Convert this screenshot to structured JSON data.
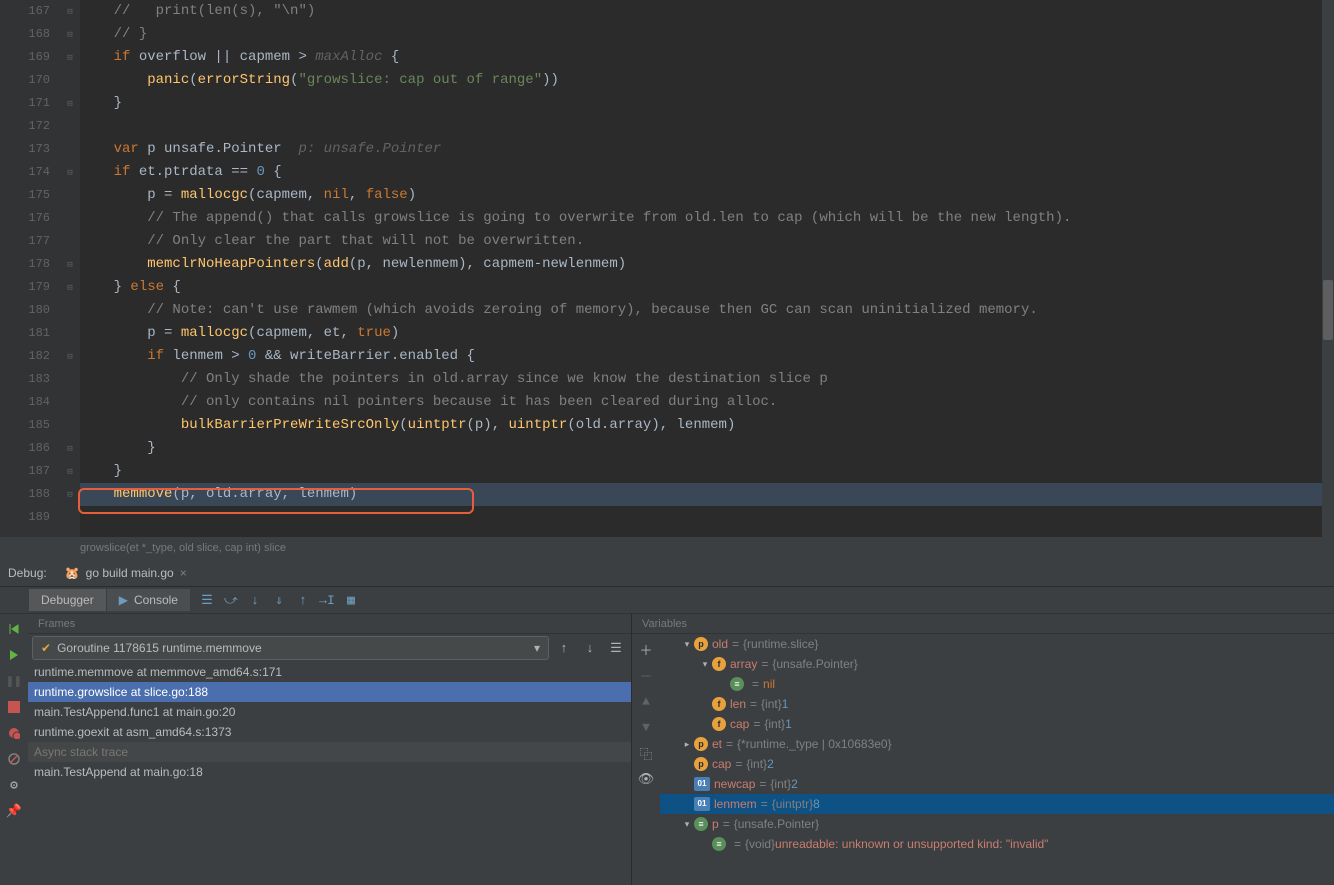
{
  "gutter": {
    "start": 167,
    "end": 189
  },
  "code_lines": [
    {
      "n": 167,
      "html": "    <span class='cmt'>//   print(len(s), \"\\n\")</span>"
    },
    {
      "n": 168,
      "html": "    <span class='cmt'>// }</span>"
    },
    {
      "n": 169,
      "html": "    <span class='kw'>if</span> overflow || capmem &gt; <span class='hint'>maxAlloc</span> {"
    },
    {
      "n": 170,
      "html": "        <span class='fn'>panic</span>(<span class='fn'>errorString</span>(<span class='str'>\"growslice: cap out of range\"</span>))"
    },
    {
      "n": 171,
      "html": "    }"
    },
    {
      "n": 172,
      "html": ""
    },
    {
      "n": 173,
      "html": "    <span class='kw'>var</span> p unsafe.<span class='typ'>Pointer</span>  <span class='hint'>p: unsafe.Pointer</span>"
    },
    {
      "n": 174,
      "html": "    <span class='kw'>if</span> et.ptrdata == <span class='num'>0</span> {"
    },
    {
      "n": 175,
      "html": "        p = <span class='fn'>mallocgc</span>(capmem, <span class='kw'>nil</span>, <span class='kw'>false</span>)"
    },
    {
      "n": 176,
      "html": "        <span class='cmt'>// The append() that calls growslice is going to overwrite from old.len to cap (which will be the new length).</span>"
    },
    {
      "n": 177,
      "html": "        <span class='cmt'>// Only clear the part that will not be overwritten.</span>"
    },
    {
      "n": 178,
      "html": "        <span class='fn'>memclrNoHeapPointers</span>(<span class='fn'>add</span>(p, newlenmem), capmem-newlenmem)"
    },
    {
      "n": 179,
      "html": "    } <span class='kw'>else</span> {"
    },
    {
      "n": 180,
      "html": "        <span class='cmt'>// Note: can't use rawmem (which avoids zeroing of memory), because then GC can scan uninitialized memory.</span>"
    },
    {
      "n": 181,
      "html": "        p = <span class='fn'>mallocgc</span>(capmem, et, <span class='kw'>true</span>)"
    },
    {
      "n": 182,
      "html": "        <span class='kw'>if</span> lenmem &gt; <span class='num'>0</span> &amp;&amp; writeBarrier.enabled {"
    },
    {
      "n": 183,
      "html": "            <span class='cmt'>// Only shade the pointers in old.array since we know the destination slice p</span>"
    },
    {
      "n": 184,
      "html": "            <span class='cmt'>// only contains nil pointers because it has been cleared during alloc.</span>"
    },
    {
      "n": 185,
      "html": "            <span class='fn'>bulkBarrierPreWriteSrcOnly</span>(<span class='fn'>uintptr</span>(p), <span class='fn'>uintptr</span>(old.array), lenmem)"
    },
    {
      "n": 186,
      "html": "        }"
    },
    {
      "n": 187,
      "html": "    }"
    },
    {
      "n": 188,
      "html": "    <span class='fn'>memmove</span>(p, old.array, lenmem)",
      "hl": true
    },
    {
      "n": 189,
      "html": ""
    }
  ],
  "breadcrumb": "growslice(et *_type, old slice, cap int) slice",
  "debug": {
    "label": "Debug:",
    "run_config": "go build main.go",
    "tabs": {
      "debugger": "Debugger",
      "console": "Console"
    }
  },
  "frames": {
    "title": "Frames",
    "goroutine": "Goroutine 1178615 runtime.memmove",
    "items": [
      {
        "text": "runtime.memmove at memmove_amd64.s:171"
      },
      {
        "text": "runtime.growslice at slice.go:188",
        "selected": true
      },
      {
        "text": "main.TestAppend.func1 at main.go:20"
      },
      {
        "text": "runtime.goexit at asm_amd64.s:1373"
      },
      {
        "text": "Async stack trace",
        "async": true
      },
      {
        "text": "main.TestAppend at main.go:18"
      }
    ]
  },
  "variables": {
    "title": "Variables",
    "tree": [
      {
        "depth": 1,
        "expand": "▾",
        "icon": "p",
        "name": "old",
        "type": "{runtime.slice}"
      },
      {
        "depth": 2,
        "expand": "▾",
        "icon": "f",
        "name": "array",
        "type": "{unsafe.Pointer}"
      },
      {
        "depth": 3,
        "expand": "",
        "icon": "e",
        "name": "",
        "val_nil": "nil"
      },
      {
        "depth": 2,
        "expand": "",
        "icon": "f",
        "name": "len",
        "type": "{int}",
        "val": "1"
      },
      {
        "depth": 2,
        "expand": "",
        "icon": "f",
        "name": "cap",
        "type": "{int}",
        "val": "1"
      },
      {
        "depth": 1,
        "expand": "▸",
        "icon": "p",
        "name": "et",
        "type": "{*runtime._type | 0x10683e0}"
      },
      {
        "depth": 1,
        "expand": "",
        "icon": "p",
        "name": "cap",
        "type": "{int}",
        "val": "2"
      },
      {
        "depth": 1,
        "expand": "",
        "icon": "01",
        "name": "newcap",
        "type": "{int}",
        "val": "2"
      },
      {
        "depth": 1,
        "expand": "",
        "icon": "01",
        "name": "lenmem",
        "type": "{uintptr}",
        "val": "8",
        "selected": true
      },
      {
        "depth": 1,
        "expand": "▾",
        "icon": "e",
        "name": "p",
        "type": "{unsafe.Pointer}"
      },
      {
        "depth": 2,
        "expand": "",
        "icon": "e",
        "name": "",
        "type": "{void}",
        "err": "unreadable: unknown or unsupported kind: \"invalid\""
      }
    ]
  }
}
